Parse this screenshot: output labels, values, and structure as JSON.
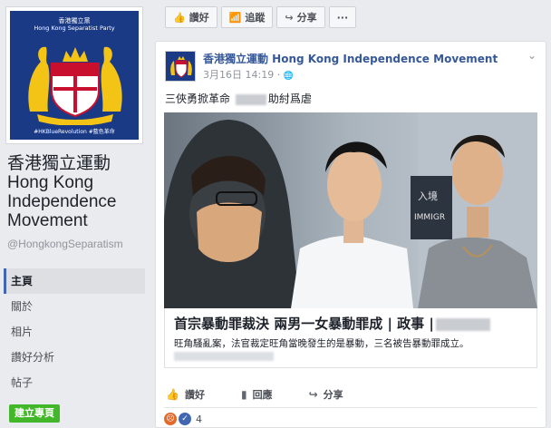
{
  "left": {
    "profile_pic": {
      "line1": "香港獨立黨",
      "line2": "Hong Kong Separatist Party",
      "tags": "#HKBlueRevolution  #藍色革命"
    },
    "page_name": "香港獨立運動 Hong Kong Independence Movement",
    "handle": "@HongkongSeparatism",
    "nav": [
      {
        "label": "主頁",
        "active": true
      },
      {
        "label": "關於",
        "active": false
      },
      {
        "label": "相片",
        "active": false
      },
      {
        "label": "讚好分析",
        "active": false
      },
      {
        "label": "帖子",
        "active": false
      }
    ],
    "create_page": "建立專頁"
  },
  "actionbar": {
    "like": "讚好",
    "follow": "追蹤",
    "share": "分享",
    "more": "···"
  },
  "post": {
    "author": "香港獨立運動 Hong Kong Independence Movement",
    "date": "3月16日 14:19 · ",
    "globe": "🌐",
    "more": "⌄",
    "text_before": "三俠勇掀革命 ",
    "text_after": "助紂爲虐",
    "article": {
      "title": "首宗暴動罪裁決 兩男一女暴動罪成 | 政事 |",
      "desc": "旺角騷亂案，法官裁定旺角當晚發生的是暴動，三名被告暴動罪成立。"
    },
    "actions": {
      "like": "讚好",
      "comment": "回應",
      "share": "分享"
    },
    "reaction_count": "4",
    "photo_sign": "入境",
    "photo_sign2": "IMMIGR"
  },
  "colors": {
    "brand": "#4267b2",
    "link": "#365899",
    "green": "#42b72a",
    "crest_blue": "#1b3a86"
  }
}
